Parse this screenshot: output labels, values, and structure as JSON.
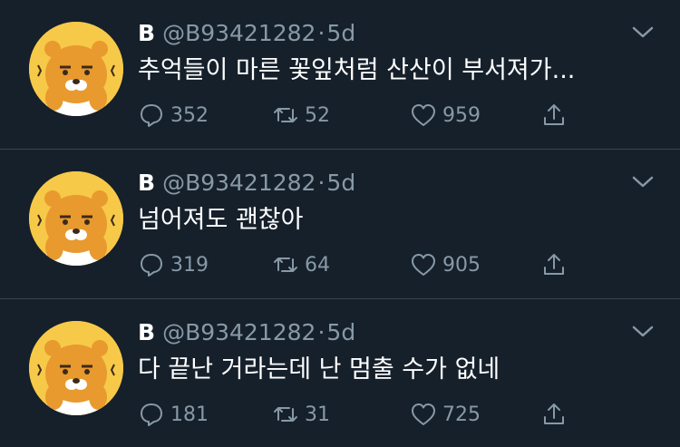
{
  "tweets": [
    {
      "name": "B",
      "handle": "@B93421282",
      "separator": "·",
      "time": "5d",
      "text": "추억들이 마른 꽃잎처럼 산산이 부서져가...",
      "replies": "352",
      "retweets": "52",
      "likes": "959"
    },
    {
      "name": "B",
      "handle": "@B93421282",
      "separator": "·",
      "time": "5d",
      "text": "넘어져도 괜찮아",
      "replies": "319",
      "retweets": "64",
      "likes": "905"
    },
    {
      "name": "B",
      "handle": "@B93421282",
      "separator": "·",
      "time": "5d",
      "text": "다 끝난 거라는데 난 멈출 수가 없네",
      "replies": "181",
      "retweets": "31",
      "likes": "725"
    }
  ],
  "icons": {
    "reply": "reply-bubble-icon",
    "retweet": "retweet-icon",
    "like": "heart-icon",
    "share": "share-upload-icon",
    "menu": "chevron-down-icon"
  },
  "colors": {
    "background": "#15202b",
    "divider": "#38444d",
    "secondary_text": "#8899a6",
    "avatar_yellow": "#f7c948"
  }
}
